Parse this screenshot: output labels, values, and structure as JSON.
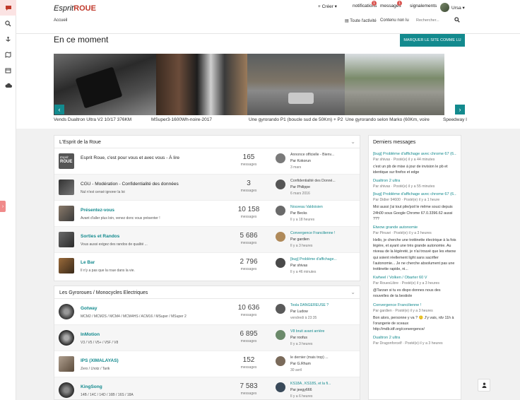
{
  "brand": {
    "part1": "Esprit",
    "part2": "ROUE"
  },
  "header": {
    "create": "+ Créer ▾",
    "notifications": "notifications",
    "notifications_count": "1",
    "messages": "messages",
    "messages_count": "1",
    "reports": "signalements",
    "user": "Ursa ▾",
    "breadcrumb": "Accueil",
    "all_activity": "Toute l'activité",
    "unread": "Contenu non lu",
    "search_placeholder": "Rechercher..."
  },
  "page": {
    "title": "En ce moment",
    "mark_read": "MARQUER LE SITE COMME LU"
  },
  "carousel": {
    "captions": [
      "Vends Dualtron Ultra V2 10/17 376KM",
      "MSuper3-1600Wh-noire-2017",
      "Une gyrorando P1 (boucle sud de 50Km) + P2",
      "Une gyrorando selon Marko (60Km, voire",
      "Speedway I"
    ],
    "prev": "‹",
    "next": "›"
  },
  "section1": {
    "title": "L'Esprit de la Roue",
    "icon_text": "Esprit ROUE",
    "forums": [
      {
        "title": "Esprit Roue, c'est pour vous et avec vous - À lire",
        "desc": "",
        "count": "165",
        "count_label": "messages",
        "last_title": "Annonce officielle - Bienv...",
        "last_by": "Par Kokorun",
        "last_date": "3 mars"
      },
      {
        "title": "CGU - Modération - Confidentialité des données",
        "desc": "Nul n'est censé ignorer la loi",
        "count": "3",
        "count_label": "messages",
        "last_title": "Confidentialité des Donné...",
        "last_by": "Par Philippe",
        "last_date": "6 mars 2016"
      },
      {
        "title": "Présentez-vous",
        "desc": "Avant d'aller plus loin, venez donc vous présenter !",
        "count": "10 158",
        "count_label": "messages",
        "last_title": "Nouveau Valdoisien",
        "last_by": "Par Becks",
        "last_date": "Il y a 18 heures"
      },
      {
        "title": "Sorties et Randos",
        "desc": "Vous aussi exigez des randos de qualité ...",
        "count": "5 686",
        "count_label": "messages",
        "last_title": "Convergence Francilienne !",
        "last_by": "Par gardien",
        "last_date": "Il y a 3 heures"
      },
      {
        "title": "Le Bar",
        "desc": "Il n'y a pas que la roue dans la vie.",
        "count": "2 796",
        "count_label": "messages",
        "last_title": "[bug] Problème d'affichage...",
        "last_by": "Par shivas",
        "last_date": "Il y a 46 minutes"
      }
    ]
  },
  "section2": {
    "title": "Les Gyroroues / Monocycles Electriques",
    "forums": [
      {
        "title": "Gotway",
        "desc": "MCM2 / MCM2S / MCM4 / MCM4HS / ACM16 / MSuper / MSuper 2",
        "count": "10 636",
        "count_label": "messages",
        "last_title": "Tesla DANGEREUSE ?",
        "last_by": "Par Ludow",
        "last_date": "vendredi à 23:35"
      },
      {
        "title": "InMotion",
        "desc": "V3 / V5 / V5+ / V5F / V8",
        "count": "6 895",
        "count_label": "messages",
        "last_title": "V8 bruit avant arrière",
        "last_by": "Par roofus",
        "last_date": "Il y a 3 heures"
      },
      {
        "title": "IPS (XIMALAYAS)",
        "desc": "Zero / Lhotz / Tarik",
        "count": "152",
        "count_label": "messages",
        "last_title": "le dernier (mais trop) ...",
        "last_by": "Par G.Rhum",
        "last_date": "30 avril"
      },
      {
        "title": "KingSong",
        "desc": "14B / 14C / 14D / 16B / 16S / 18A",
        "count": "7 583",
        "count_label": "messages",
        "last_title": "KS18A , KS18S, et la fi...",
        "last_by": "Par jeegy666",
        "last_date": "Il y a 6 heures"
      }
    ]
  },
  "recent": {
    "title": "Derniers messages",
    "items": [
      {
        "title": "[bug] Problème d'affichage avec chrome 67 (6...",
        "meta": "Par shivas · Posté(e) il y a 44 minutes",
        "body": "c'est un pb de mise à jour de invision le pb et identique sur firefox et edge"
      },
      {
        "title": "Dualtron 2 ultra",
        "meta": "Par shivas · Posté(e) il y a 55 minutes",
        "body": ""
      },
      {
        "title": "[bug] Problème d'affichage avec chrome 67 (6...",
        "meta": "Par Didier 94600 · Posté(e) il y a 1 heure",
        "body": "Moi aussi j'ai tout pile/poil le même souci depuis 24h00 sous Google Chrome 67.0.3396.62 aussi ???"
      },
      {
        "title": "Etwow grande autonomie",
        "meta": "Par Pinuwi · Posté(e) il y a 3 heures",
        "body": "Hello, je cherche une trottinette électrique à la fois légère, et ayant une très grande autonomie. Au niveau de la légèreté, je n'ai trouvé que les etwow qui soient réellement light sans sacrifier l'autonomie... Je ne cherche absolument pas une trottinette rapide, ni..."
      },
      {
        "title": "Kwheel / Volken / Obarter 60 V",
        "meta": "Par RouesLibre · Posté(e) il y a 3 heures",
        "body": "@Tarzan si tu es dispo donnes nous des nouvelles de ta bestiole"
      },
      {
        "title": "Convergence Francilienne !",
        "meta": "Par gardien · Posté(e) il y a 3 heures",
        "body": "Bon alors, personne y va ? 🙂 J'y vais, rdv 11h à l'orangerie de sceaux http://mdb.idf.org/convergence/"
      },
      {
        "title": "Dualtron 2 ultra",
        "meta": "Par Dragonforcelf · Posté(e) il y a 3 heures",
        "body": ""
      }
    ]
  },
  "colors": {
    "accent": "#138a8e",
    "brand_red": "#c0392b",
    "badge": "#d9534f"
  }
}
